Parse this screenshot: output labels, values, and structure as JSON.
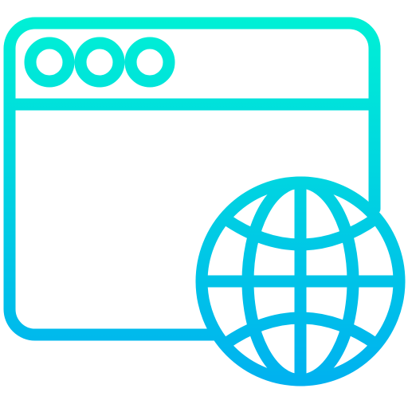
{
  "icon": {
    "name": "browser-window-with-globe-icon",
    "window_icon": "browser-window-icon",
    "globe_icon": "globe-icon",
    "window_control_dots": 3
  },
  "colors": {
    "gradient_top": "#00F0D5",
    "gradient_bottom": "#00B0F0",
    "background": "#FFFFFF"
  }
}
